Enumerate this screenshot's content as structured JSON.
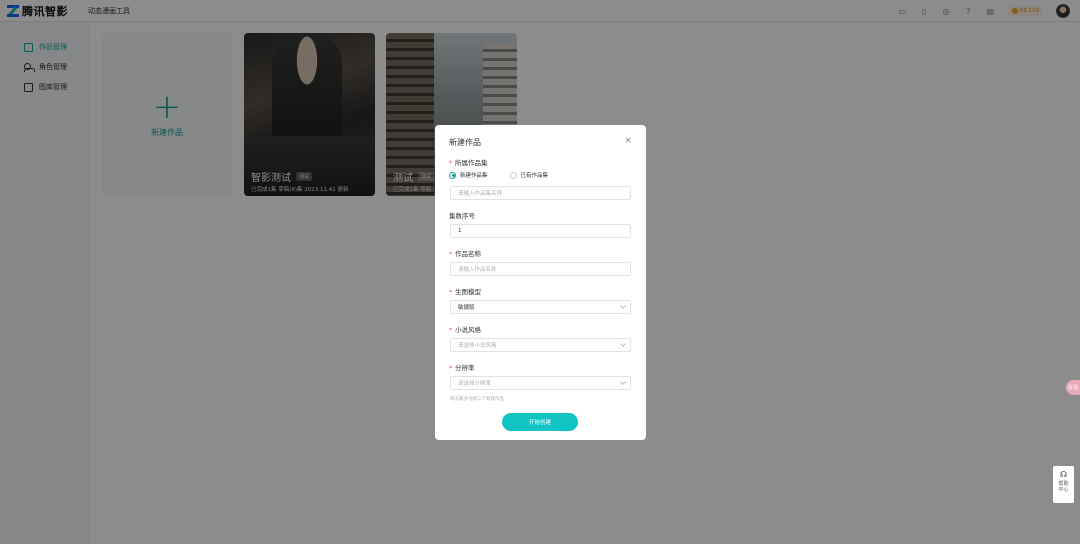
{
  "header": {
    "logo_text": "腾讯智影",
    "app_title": "动态漫画工具",
    "coins": "55,110"
  },
  "sidebar": {
    "items": [
      {
        "label": "作品管理",
        "active": true
      },
      {
        "label": "角色管理",
        "active": false
      },
      {
        "label": "图库管理",
        "active": false
      }
    ]
  },
  "main": {
    "new_card_label": "新建作品",
    "works": [
      {
        "title": "智影测试",
        "tag": "测试",
        "meta": "已完成1集 草稿(8)集 2023.11.41 更新"
      },
      {
        "title": "测试",
        "tag": "测试",
        "meta": "已完成1集 草稿"
      }
    ]
  },
  "modal": {
    "title": "新建作品",
    "close": "×",
    "fields": {
      "collection": {
        "label": "所属作品集",
        "options": [
          "新建作品集",
          "已有作品集"
        ],
        "placeholder": "请输入作品集名称"
      },
      "episode": {
        "label": "集数序号",
        "value": "1"
      },
      "name": {
        "label": "作品名称",
        "placeholder": "请输入作品名称"
      },
      "model": {
        "label": "生图模型",
        "value": "敏捷版"
      },
      "style": {
        "label": "小说风格",
        "placeholder": "请选择小说风格"
      },
      "resolution": {
        "label": "分辨率",
        "placeholder": "请选择分辨率"
      }
    },
    "hint": "每天最多创建三个新建作品",
    "start_button": "开始创建"
  },
  "float": {
    "pill": "反馈",
    "help_text": "帮助中心"
  }
}
